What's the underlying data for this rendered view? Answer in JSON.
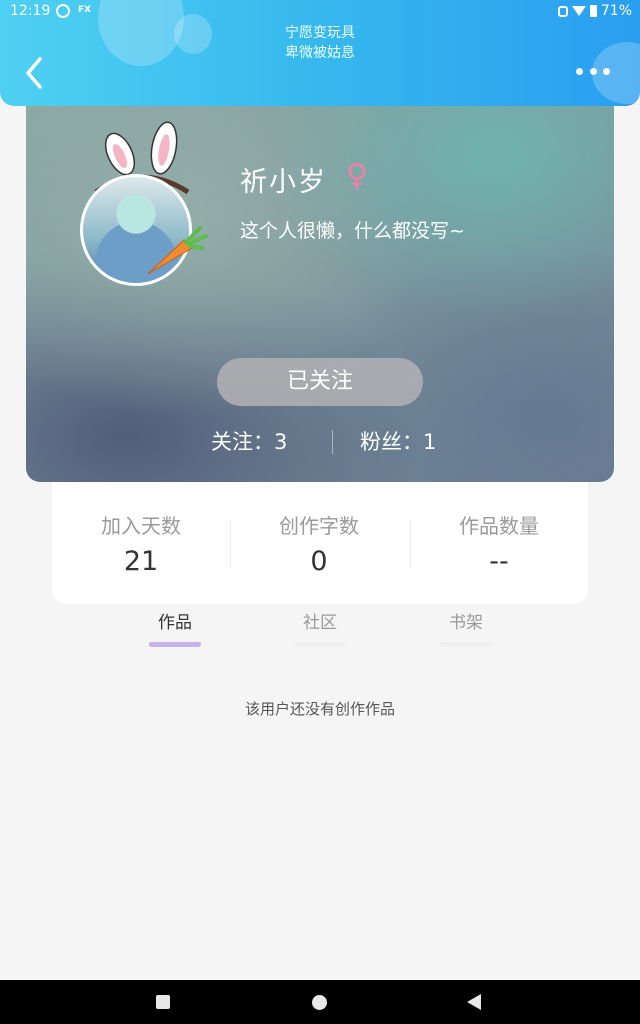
{
  "status_bar": {
    "time": "12:19",
    "fx_label": "FX",
    "battery": "71%"
  },
  "header": {
    "marquee_line1": "宁愿变玩具",
    "marquee_line2": "卑微被姑息",
    "back_icon": "chevron-left-icon",
    "more_icon": "more-horizontal-icon"
  },
  "profile": {
    "name": "祈小岁",
    "gender_symbol": "♀",
    "bio": "这个人很懒，什么都没写~",
    "follow_label": "已关注",
    "following": "关注：3",
    "followers": "粉丝：1"
  },
  "stats": [
    {
      "label": "加入天数",
      "value": "21"
    },
    {
      "label": "创作字数",
      "value": "0"
    },
    {
      "label": "作品数量",
      "value": "--"
    }
  ],
  "tabs": [
    {
      "label": "作品",
      "active": true
    },
    {
      "label": "社区",
      "active": false
    },
    {
      "label": "书架",
      "active": false
    }
  ],
  "empty_message": "该用户还没有创作作品",
  "colors": {
    "header_start": "#4fd0f2",
    "header_end": "#2a9ef0",
    "gender_pink": "#f27fa7",
    "tab_active_bar": "#c8b1e8"
  }
}
